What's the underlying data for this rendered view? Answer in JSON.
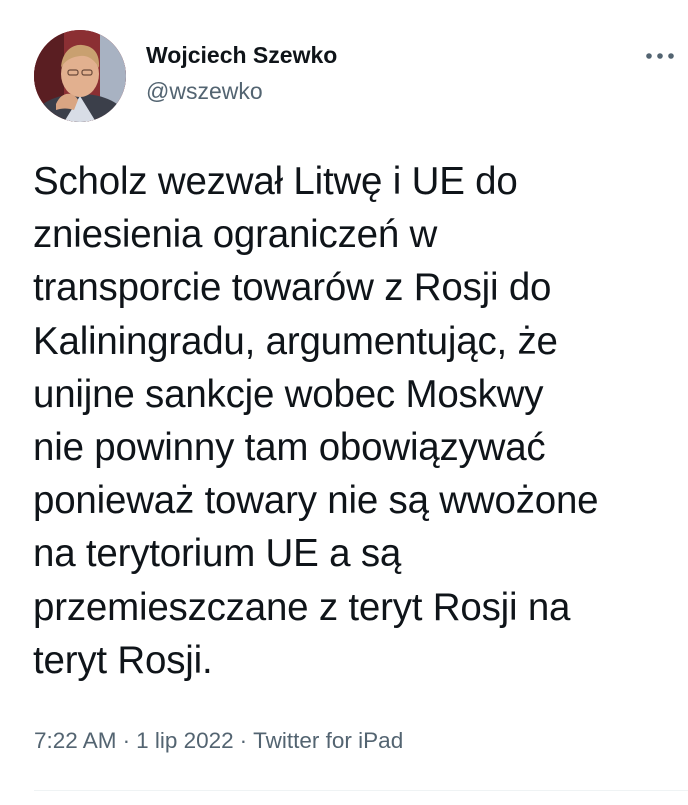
{
  "author": {
    "name": "Wojciech Szewko",
    "handle": "@wszewko"
  },
  "tweet": {
    "text": "Scholz wezwał Litwę i UE do\nzniesienia ograniczeń w\ntransporcie towarów z Rosji do\nKaliningradu, argumentując, że\nunijne sankcje wobec Moskwy\nnie powinny tam obowiązywać\nponieważ towary nie są wwożone\nna terytorium UE a są\nprzemieszczane z teryt Rosji na\nteryt Rosji."
  },
  "meta": {
    "time": "7:22 AM",
    "separator": "·",
    "date": "1 lip 2022",
    "source": "Twitter for iPad"
  },
  "icons": {
    "more": "more-horizontal-icon",
    "avatar": "profile-photo"
  },
  "colors": {
    "text_primary": "#0f1419",
    "text_secondary": "#536471",
    "divider": "#eff3f4"
  }
}
